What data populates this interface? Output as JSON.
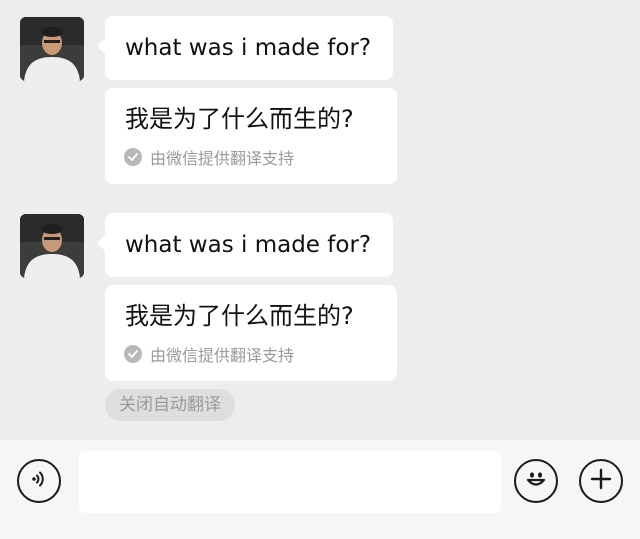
{
  "messages": [
    {
      "original": "what was i made for?",
      "translation": "我是为了什么而生的?",
      "translation_note": "由微信提供翻译支持"
    },
    {
      "original": "what was i made for?",
      "translation": "我是为了什么而生的?",
      "translation_note": "由微信提供翻译支持"
    }
  ],
  "auto_translate_toggle": "关闭自动翻译",
  "input_bar": {
    "voice_icon": "voice-icon",
    "emoji_icon": "emoji-icon",
    "add_icon": "plus-icon",
    "input_value": ""
  },
  "colors": {
    "background": "#ededed",
    "bubble": "#ffffff",
    "muted_text": "#9a9a9a",
    "input_bar": "#f6f6f6"
  }
}
